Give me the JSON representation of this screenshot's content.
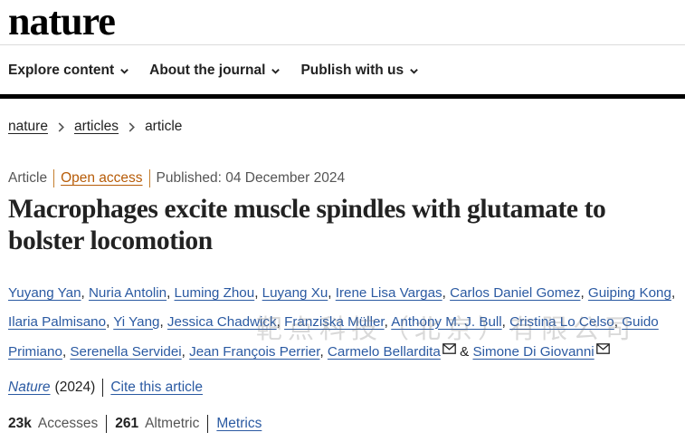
{
  "site": {
    "logo": "nature"
  },
  "nav": {
    "items": [
      {
        "label": "Explore content"
      },
      {
        "label": "About the journal"
      },
      {
        "label": "Publish with us"
      }
    ]
  },
  "breadcrumb": {
    "items": [
      "nature",
      "articles",
      "article"
    ]
  },
  "meta": {
    "type": "Article",
    "access": "Open access",
    "published": "Published: 04 December 2024"
  },
  "article": {
    "title": "Macrophages excite muscle spindles with glutamate to bolster locomotion",
    "authors": [
      "Yuyang Yan",
      "Nuria Antolin",
      "Luming Zhou",
      "Luyang Xu",
      "Irene Lisa Vargas",
      "Carlos Daniel Gomez",
      "Guiping Kong",
      "Ilaria Palmisano",
      "Yi Yang",
      "Jessica Chadwick",
      "Franziska Müller",
      "Anthony M. J. Bull",
      "Cristina Lo Celso",
      "Guido Primiano",
      "Serenella Servidei",
      "Jean François Perrier",
      "Carmelo Bellardita",
      "Simone Di Giovanni"
    ],
    "author_separator": ", ",
    "author_and": "&"
  },
  "watermark": "靶点科技（北京）有限公司",
  "citation": {
    "journal": "Nature",
    "year": "(2024)",
    "cite_label": "Cite this article"
  },
  "metrics": {
    "accesses_value": "23k",
    "accesses_label": "Accesses",
    "altmetric_value": "261",
    "altmetric_label": "Altmetric",
    "metrics_link": "Metrics"
  },
  "colors": {
    "link": "#2b5aa2",
    "open_access": "#b75c08",
    "rule": "#000000"
  },
  "icons": {
    "nav_dropdown": "chevron-down-icon",
    "breadcrumb": "chevron-right-icon",
    "corresponding": "mail-icon"
  }
}
